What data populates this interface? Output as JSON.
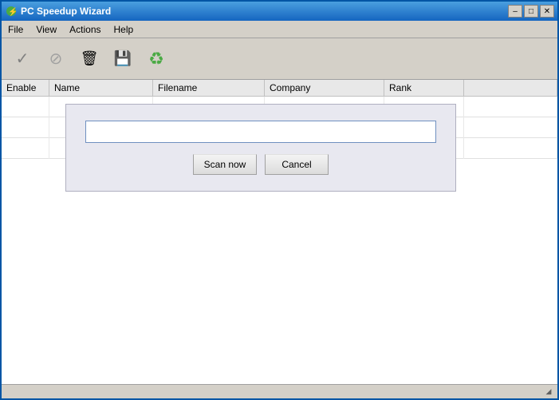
{
  "window": {
    "title": "PC Speedup Wizard",
    "controls": {
      "minimize": "–",
      "maximize": "□",
      "close": "✕"
    }
  },
  "menu": {
    "items": [
      "File",
      "View",
      "Actions",
      "Help"
    ]
  },
  "toolbar": {
    "buttons": [
      {
        "name": "enable-button",
        "icon": "check",
        "label": "Enable"
      },
      {
        "name": "disable-button",
        "icon": "cancel",
        "label": "Disable"
      },
      {
        "name": "delete-button",
        "icon": "trash",
        "label": "Delete"
      },
      {
        "name": "save-button",
        "icon": "save",
        "label": "Save"
      },
      {
        "name": "recycle-button",
        "icon": "recycle",
        "label": "Recycle"
      }
    ]
  },
  "table": {
    "columns": [
      "Enable",
      "Name",
      "Filename",
      "Company",
      "Rank"
    ],
    "rows": []
  },
  "dialog": {
    "input_placeholder": "",
    "scan_button": "Scan now",
    "cancel_button": "Cancel"
  },
  "statusbar": {
    "corner": "◢"
  }
}
